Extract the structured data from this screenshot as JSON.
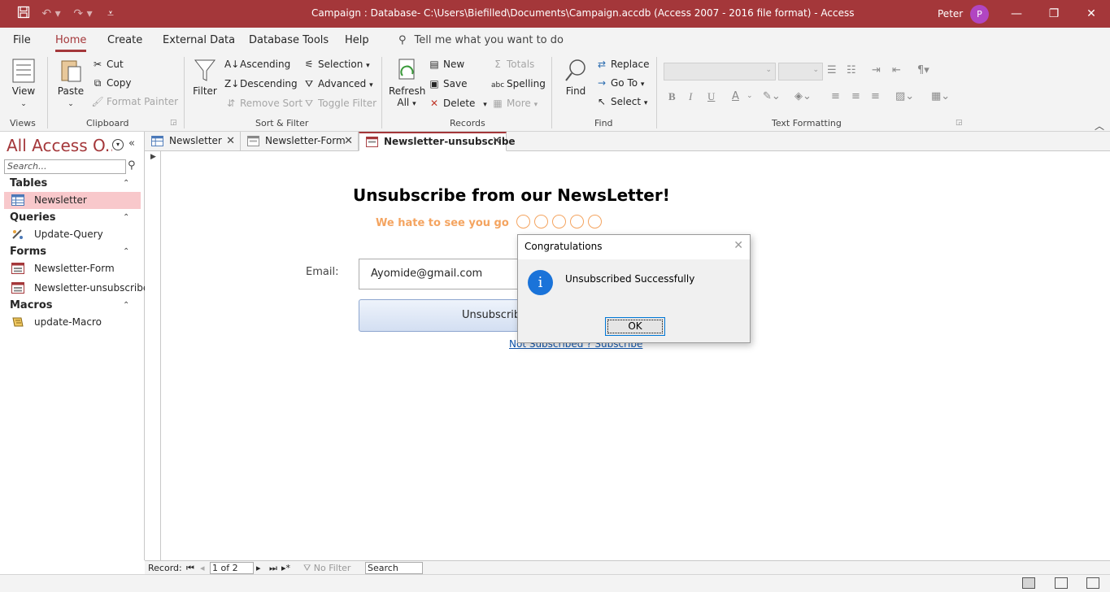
{
  "titlebar": {
    "title": "Campaign : Database- C:\\Users\\Biefilled\\Documents\\Campaign.accdb (Access 2007 - 2016 file format)  -  Access",
    "user": "Peter",
    "avatar_initial": "P",
    "qa_icons": [
      "save-icon",
      "undo-icon",
      "redo-icon",
      "customize-icon"
    ],
    "window_controls": [
      "minimize-icon",
      "restore-icon",
      "close-icon"
    ]
  },
  "ribbon_tabs": [
    "File",
    "Home",
    "Create",
    "External Data",
    "Database Tools",
    "Help"
  ],
  "active_tab": "Home",
  "tell_me": "Tell me what you want to do",
  "ribbon": {
    "views": {
      "view": "View",
      "label": "Views"
    },
    "clipboard": {
      "paste": "Paste",
      "cut": "Cut",
      "copy": "Copy",
      "format_painter": "Format Painter",
      "label": "Clipboard"
    },
    "sort_filter": {
      "filter": "Filter",
      "ascending": "Ascending",
      "descending": "Descending",
      "remove_sort": "Remove Sort",
      "selection": "Selection",
      "advanced": "Advanced",
      "toggle_filter": "Toggle Filter",
      "label": "Sort & Filter"
    },
    "records": {
      "refresh": "Refresh",
      "refresh_all": "All",
      "new": "New",
      "save": "Save",
      "delete": "Delete",
      "totals": "Totals",
      "spelling": "Spelling",
      "more": "More",
      "label": "Records"
    },
    "find": {
      "find": "Find",
      "replace": "Replace",
      "goto": "Go To",
      "select": "Select",
      "label": "Find"
    },
    "text_formatting": {
      "label": "Text Formatting",
      "bold": "B",
      "italic": "I",
      "underline": "U",
      "font_color": "A"
    }
  },
  "nav": {
    "title": "All Access O...",
    "search_placeholder": "Search...",
    "groups": [
      {
        "name": "Tables",
        "items": [
          "Newsletter"
        ]
      },
      {
        "name": "Queries",
        "items": [
          "Update-Query"
        ]
      },
      {
        "name": "Forms",
        "items": [
          "Newsletter-Form",
          "Newsletter-unsubscribe"
        ]
      },
      {
        "name": "Macros",
        "items": [
          "update-Macro"
        ]
      }
    ],
    "selected": "Newsletter"
  },
  "doc_tabs": [
    "Newsletter",
    "Newsletter-Form",
    "Newsletter-unsubscribe"
  ],
  "active_doc": "Newsletter-unsubscribe",
  "form": {
    "title": "Unsubscribe from our NewsLetter!",
    "subtitle": "We hate to see you go",
    "email_label": "Email:",
    "email_value": "Ayomide@gmail.com",
    "button": "Unsubscribe",
    "link": "Not Subscribed ? Subscribe"
  },
  "dialog": {
    "title": "Congratulations",
    "message": "Unsubscribed Successfully",
    "ok": "OK",
    "icon": "info-icon"
  },
  "record_nav": {
    "label": "Record:",
    "position": "1 of 2",
    "filter": "No Filter",
    "search": "Search"
  },
  "colors": {
    "accent": "#a4373a",
    "nav_selected": "#f8c8cb",
    "subtitle": "#f4a460",
    "link": "#1155aa",
    "info_icon": "#1a73d9"
  }
}
